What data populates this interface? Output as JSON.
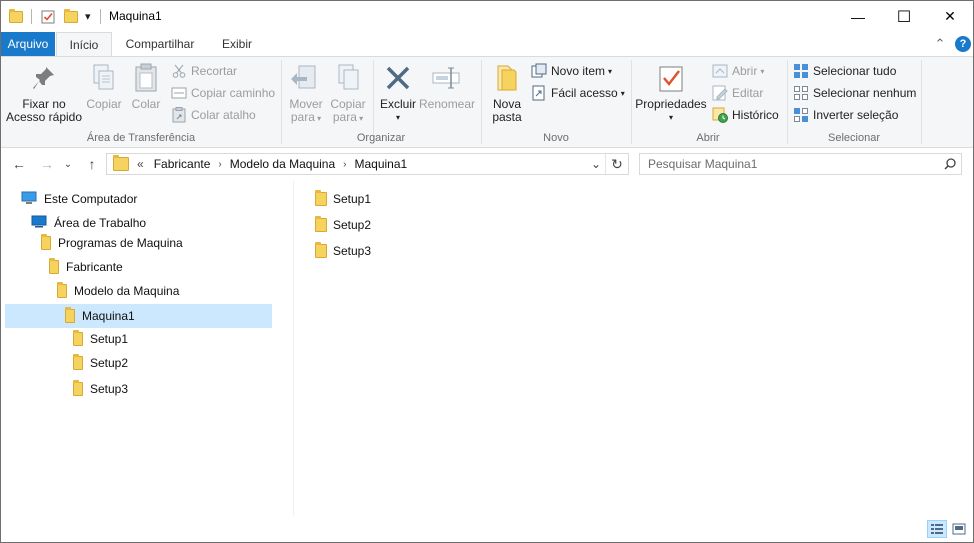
{
  "window": {
    "title": "Maquina1",
    "minimize_glyph": "—",
    "maximize_glyph": "☐",
    "close_glyph": "✕"
  },
  "quick_access": {
    "dropdown_glyph": "▾"
  },
  "tabs": [
    {
      "label": "Arquivo"
    },
    {
      "label": "Início"
    },
    {
      "label": "Compartilhar"
    },
    {
      "label": "Exibir"
    }
  ],
  "ribbon": {
    "collapse_glyph": "⌃",
    "help_glyph": "?",
    "clipboard": {
      "label": "Área de Transferência",
      "pin_label_1": "Fixar no",
      "pin_label_2": "Acesso rápido",
      "copy_label": "Copiar",
      "paste_label": "Colar",
      "cut_label": "Recortar",
      "copy_path_label": "Copiar caminho",
      "paste_shortcut_label": "Colar atalho"
    },
    "organize": {
      "label": "Organizar",
      "move_label_1": "Mover",
      "move_label_2": "para",
      "copy_label_1": "Copiar",
      "copy_label_2": "para",
      "delete_label": "Excluir",
      "rename_label": "Renomear"
    },
    "new": {
      "label": "Novo",
      "new_folder_label_1": "Nova",
      "new_folder_label_2": "pasta",
      "new_item_label": "Novo item",
      "easy_access_label": "Fácil acesso"
    },
    "open": {
      "label": "Abrir",
      "properties_label": "Propriedades",
      "open_label": "Abrir",
      "edit_label": "Editar",
      "history_label": "Histórico"
    },
    "select": {
      "label": "Selecionar",
      "select_all_label": "Selecionar tudo",
      "select_none_label": "Selecionar nenhum",
      "invert_label": "Inverter seleção"
    }
  },
  "address": {
    "overflow": "«",
    "crumbs": [
      "Fabricante",
      "Modelo da Maquina",
      "Maquina1"
    ],
    "separator": "›",
    "dropdown_glyph": "⌄",
    "refresh_glyph": "↻"
  },
  "search": {
    "placeholder": "Pesquisar Maquina1"
  },
  "nav_tree": [
    {
      "label": "Este Computador"
    },
    {
      "label": "Área de Trabalho"
    },
    {
      "label": "Programas de Maquina"
    },
    {
      "label": "Fabricante"
    },
    {
      "label": "Modelo da Maquina"
    },
    {
      "label": "Maquina1",
      "selected": true
    },
    {
      "label": "Setup1"
    },
    {
      "label": "Setup2"
    },
    {
      "label": "Setup3"
    }
  ],
  "files": [
    {
      "name": "Setup1"
    },
    {
      "name": "Setup2"
    },
    {
      "name": "Setup3"
    }
  ],
  "colors": {
    "accent": "#1979ca",
    "selection": "#cce8ff",
    "folder": "#f6d35e"
  }
}
